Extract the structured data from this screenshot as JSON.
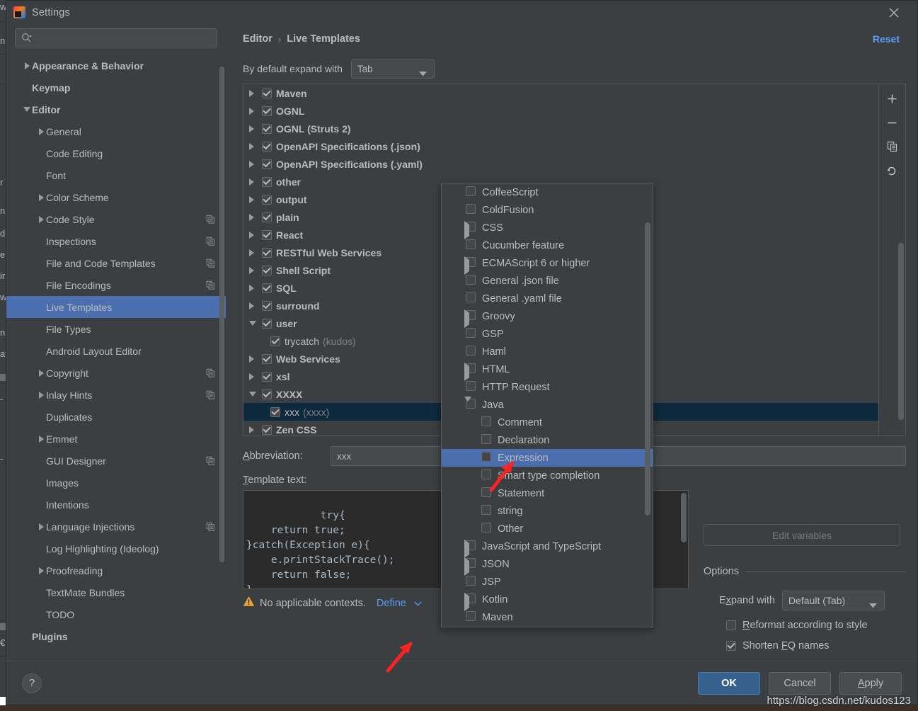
{
  "window": {
    "title": "Settings",
    "logo_text": "IJ",
    "close_icon": "close-icon"
  },
  "search": {
    "placeholder": "",
    "value": "",
    "icon": "search-icon"
  },
  "sidebar": {
    "items": [
      {
        "label": "Appearance & Behavior",
        "arrow": "right",
        "bold": true,
        "indent": 0,
        "copy": false,
        "selected": false
      },
      {
        "label": "Keymap",
        "arrow": "none",
        "bold": true,
        "indent": 0,
        "copy": false,
        "selected": false
      },
      {
        "label": "Editor",
        "arrow": "down",
        "bold": true,
        "indent": 0,
        "copy": false,
        "selected": false
      },
      {
        "label": "General",
        "arrow": "right",
        "bold": false,
        "indent": 1,
        "copy": false,
        "selected": false
      },
      {
        "label": "Code Editing",
        "arrow": "none",
        "bold": false,
        "indent": 1,
        "copy": false,
        "selected": false
      },
      {
        "label": "Font",
        "arrow": "none",
        "bold": false,
        "indent": 1,
        "copy": false,
        "selected": false
      },
      {
        "label": "Color Scheme",
        "arrow": "right",
        "bold": false,
        "indent": 1,
        "copy": false,
        "selected": false
      },
      {
        "label": "Code Style",
        "arrow": "right",
        "bold": false,
        "indent": 1,
        "copy": true,
        "selected": false
      },
      {
        "label": "Inspections",
        "arrow": "none",
        "bold": false,
        "indent": 1,
        "copy": true,
        "selected": false
      },
      {
        "label": "File and Code Templates",
        "arrow": "none",
        "bold": false,
        "indent": 1,
        "copy": true,
        "selected": false
      },
      {
        "label": "File Encodings",
        "arrow": "none",
        "bold": false,
        "indent": 1,
        "copy": true,
        "selected": false
      },
      {
        "label": "Live Templates",
        "arrow": "none",
        "bold": false,
        "indent": 1,
        "copy": false,
        "selected": true
      },
      {
        "label": "File Types",
        "arrow": "none",
        "bold": false,
        "indent": 1,
        "copy": false,
        "selected": false
      },
      {
        "label": "Android Layout Editor",
        "arrow": "none",
        "bold": false,
        "indent": 1,
        "copy": false,
        "selected": false
      },
      {
        "label": "Copyright",
        "arrow": "right",
        "bold": false,
        "indent": 1,
        "copy": true,
        "selected": false
      },
      {
        "label": "Inlay Hints",
        "arrow": "right",
        "bold": false,
        "indent": 1,
        "copy": true,
        "selected": false
      },
      {
        "label": "Duplicates",
        "arrow": "none",
        "bold": false,
        "indent": 1,
        "copy": false,
        "selected": false
      },
      {
        "label": "Emmet",
        "arrow": "right",
        "bold": false,
        "indent": 1,
        "copy": false,
        "selected": false
      },
      {
        "label": "GUI Designer",
        "arrow": "none",
        "bold": false,
        "indent": 1,
        "copy": true,
        "selected": false
      },
      {
        "label": "Images",
        "arrow": "none",
        "bold": false,
        "indent": 1,
        "copy": false,
        "selected": false
      },
      {
        "label": "Intentions",
        "arrow": "none",
        "bold": false,
        "indent": 1,
        "copy": false,
        "selected": false
      },
      {
        "label": "Language Injections",
        "arrow": "right",
        "bold": false,
        "indent": 1,
        "copy": true,
        "selected": false
      },
      {
        "label": "Log Highlighting (Ideolog)",
        "arrow": "none",
        "bold": false,
        "indent": 1,
        "copy": false,
        "selected": false
      },
      {
        "label": "Proofreading",
        "arrow": "right",
        "bold": false,
        "indent": 1,
        "copy": false,
        "selected": false
      },
      {
        "label": "TextMate Bundles",
        "arrow": "none",
        "bold": false,
        "indent": 1,
        "copy": false,
        "selected": false
      },
      {
        "label": "TODO",
        "arrow": "none",
        "bold": false,
        "indent": 1,
        "copy": false,
        "selected": false
      },
      {
        "label": "Plugins",
        "arrow": "none",
        "bold": true,
        "indent": 0,
        "copy": false,
        "selected": false
      }
    ]
  },
  "breadcrumb": {
    "parent": "Editor",
    "separator": "›",
    "current": "Live Templates"
  },
  "reset_label": "Reset",
  "expand_default": {
    "label": "By default expand with",
    "value": "Tab"
  },
  "template_tree": {
    "rows": [
      {
        "label": "Maven",
        "arrow": "right",
        "checked": true,
        "child": false,
        "selected": false,
        "suffix": ""
      },
      {
        "label": "OGNL",
        "arrow": "right",
        "checked": true,
        "child": false,
        "selected": false,
        "suffix": ""
      },
      {
        "label": "OGNL (Struts 2)",
        "arrow": "right",
        "checked": true,
        "child": false,
        "selected": false,
        "suffix": ""
      },
      {
        "label": "OpenAPI Specifications (.json)",
        "arrow": "right",
        "checked": true,
        "child": false,
        "selected": false,
        "suffix": ""
      },
      {
        "label": "OpenAPI Specifications (.yaml)",
        "arrow": "right",
        "checked": true,
        "child": false,
        "selected": false,
        "suffix": ""
      },
      {
        "label": "other",
        "arrow": "right",
        "checked": true,
        "child": false,
        "selected": false,
        "suffix": ""
      },
      {
        "label": "output",
        "arrow": "right",
        "checked": true,
        "child": false,
        "selected": false,
        "suffix": ""
      },
      {
        "label": "plain",
        "arrow": "right",
        "checked": true,
        "child": false,
        "selected": false,
        "suffix": ""
      },
      {
        "label": "React",
        "arrow": "right",
        "checked": true,
        "child": false,
        "selected": false,
        "suffix": ""
      },
      {
        "label": "RESTful Web Services",
        "arrow": "right",
        "checked": true,
        "child": false,
        "selected": false,
        "suffix": ""
      },
      {
        "label": "Shell Script",
        "arrow": "right",
        "checked": true,
        "child": false,
        "selected": false,
        "suffix": ""
      },
      {
        "label": "SQL",
        "arrow": "right",
        "checked": true,
        "child": false,
        "selected": false,
        "suffix": ""
      },
      {
        "label": "surround",
        "arrow": "right",
        "checked": true,
        "child": false,
        "selected": false,
        "suffix": ""
      },
      {
        "label": "user",
        "arrow": "down",
        "checked": true,
        "child": false,
        "selected": false,
        "suffix": ""
      },
      {
        "label": "trycatch",
        "arrow": "none",
        "checked": true,
        "child": true,
        "selected": false,
        "suffix": "(kudos)"
      },
      {
        "label": "Web Services",
        "arrow": "right",
        "checked": true,
        "child": false,
        "selected": false,
        "suffix": ""
      },
      {
        "label": "xsl",
        "arrow": "right",
        "checked": true,
        "child": false,
        "selected": false,
        "suffix": ""
      },
      {
        "label": "XXXX",
        "arrow": "down",
        "checked": true,
        "child": false,
        "selected": false,
        "suffix": ""
      },
      {
        "label": "xxx",
        "arrow": "none",
        "checked": true,
        "child": true,
        "selected": true,
        "suffix": "(xxxx)"
      },
      {
        "label": "Zen CSS",
        "arrow": "right",
        "checked": true,
        "child": false,
        "selected": false,
        "suffix": ""
      }
    ],
    "toolbar": [
      {
        "icon": "add-icon",
        "name": "add-template-button"
      },
      {
        "icon": "remove-icon",
        "name": "remove-template-button"
      },
      {
        "icon": "duplicate-icon",
        "name": "duplicate-template-button"
      },
      {
        "icon": "revert-icon",
        "name": "revert-template-button"
      }
    ]
  },
  "abbreviation": {
    "label": "Abbreviation:",
    "label_mnemonic": "A",
    "value": "xxx"
  },
  "template_text": {
    "label": "Template text:",
    "code": "try{\n    return true;\n}catch(Exception e){\n    e.printStackTrace();\n    return false;\n}"
  },
  "context_warning": {
    "icon": "warning-icon",
    "text": "No applicable contexts.",
    "define_label": "Define",
    "chevron": "chevron-down-icon"
  },
  "edit_variables": {
    "label": "Edit variables",
    "enabled": false
  },
  "options": {
    "title": "Options",
    "expand_with_label": "Expand with",
    "expand_with_value": "Default (Tab)",
    "checkboxes": [
      {
        "label": "Reformat according to style",
        "checked": false,
        "mnemonic": "R"
      },
      {
        "label": "Shorten FQ names",
        "checked": true,
        "mnemonic": "F"
      }
    ]
  },
  "context_popup": {
    "rows": [
      {
        "label": "CoffeeScript",
        "arrow": "none",
        "level": 0,
        "selected": false
      },
      {
        "label": "ColdFusion",
        "arrow": "none",
        "level": 0,
        "selected": false
      },
      {
        "label": "CSS",
        "arrow": "right",
        "level": 0,
        "selected": false
      },
      {
        "label": "Cucumber feature",
        "arrow": "none",
        "level": 0,
        "selected": false
      },
      {
        "label": "ECMAScript 6 or higher",
        "arrow": "right",
        "level": 0,
        "selected": false
      },
      {
        "label": "General .json file",
        "arrow": "none",
        "level": 0,
        "selected": false
      },
      {
        "label": "General .yaml file",
        "arrow": "none",
        "level": 0,
        "selected": false
      },
      {
        "label": "Groovy",
        "arrow": "right",
        "level": 0,
        "selected": false
      },
      {
        "label": "GSP",
        "arrow": "none",
        "level": 0,
        "selected": false
      },
      {
        "label": "Haml",
        "arrow": "none",
        "level": 0,
        "selected": false
      },
      {
        "label": "HTML",
        "arrow": "right",
        "level": 0,
        "selected": false
      },
      {
        "label": "HTTP Request",
        "arrow": "none",
        "level": 0,
        "selected": false
      },
      {
        "label": "Java",
        "arrow": "down",
        "level": 0,
        "selected": false
      },
      {
        "label": "Comment",
        "arrow": "none",
        "level": 1,
        "selected": false
      },
      {
        "label": "Declaration",
        "arrow": "none",
        "level": 1,
        "selected": false
      },
      {
        "label": "Expression",
        "arrow": "none",
        "level": 1,
        "selected": true
      },
      {
        "label": "Smart type completion",
        "arrow": "none",
        "level": 1,
        "selected": false
      },
      {
        "label": "Statement",
        "arrow": "none",
        "level": 1,
        "selected": false
      },
      {
        "label": "string",
        "arrow": "none",
        "level": 1,
        "selected": false
      },
      {
        "label": "Other",
        "arrow": "none",
        "level": 1,
        "selected": false
      },
      {
        "label": "JavaScript and TypeScript",
        "arrow": "right",
        "level": 0,
        "selected": false
      },
      {
        "label": "JSON",
        "arrow": "right",
        "level": 0,
        "selected": false
      },
      {
        "label": "JSP",
        "arrow": "none",
        "level": 0,
        "selected": false
      },
      {
        "label": "Kotlin",
        "arrow": "right",
        "level": 0,
        "selected": false
      },
      {
        "label": "Maven",
        "arrow": "none",
        "level": 0,
        "selected": false
      }
    ]
  },
  "footer": {
    "help_label": "?",
    "ok_label": "OK",
    "cancel_label": "Cancel",
    "apply_label": "Apply"
  },
  "watermark": "https://blog.csdn.net/kudos123",
  "colors": {
    "dialog_bg": "#3c3f41",
    "accent_selection": "#4b6eaf",
    "tree_selection": "#0d293e",
    "link": "#589df6",
    "primary_button": "#36618f",
    "arrow_annotation": "#ff2222"
  },
  "underlying_window": {
    "fragments": [
      "w",
      "n",
      "r",
      "n",
      "d",
      "e",
      "ir",
      "w",
      "n",
      "av",
      "t",
      "€"
    ]
  }
}
